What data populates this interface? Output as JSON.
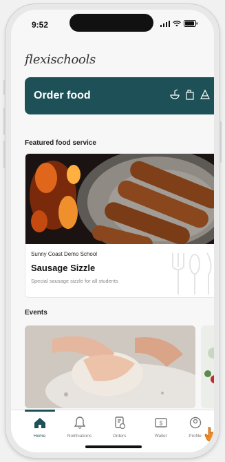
{
  "status_bar": {
    "time": "9:52"
  },
  "app": {
    "logo_text": "flexischools"
  },
  "order_card": {
    "title": "Order food",
    "icons": [
      "takeaway-icon",
      "lunch-bag-icon",
      "cake-icon"
    ]
  },
  "featured": {
    "section_title": "Featured food service",
    "school": "Sunny Coast Demo School",
    "title": "Sausage Sizzle",
    "description": "Special sausage sizzle for all students"
  },
  "events": {
    "section_title": "Events"
  },
  "bottom_nav": {
    "items": [
      {
        "label": "Home",
        "icon": "home-icon",
        "active": true
      },
      {
        "label": "Notifications",
        "icon": "bell-icon",
        "active": false
      },
      {
        "label": "Orders",
        "icon": "orders-icon",
        "active": false
      },
      {
        "label": "Wallet",
        "icon": "wallet-icon",
        "active": false
      },
      {
        "label": "Profile",
        "icon": "profile-icon",
        "active": false
      }
    ]
  },
  "colors": {
    "brand": "#1e5157",
    "background": "#f7f7f7",
    "cursor": "#f08a24"
  }
}
